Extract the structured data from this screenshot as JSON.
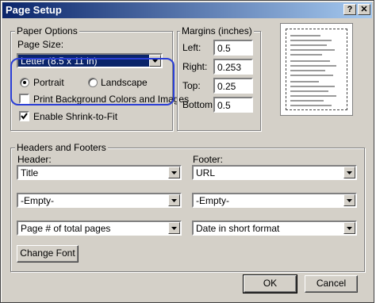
{
  "window": {
    "title": "Page Setup"
  },
  "paper_options": {
    "group_label": "Paper Options",
    "page_size_label": "Page Size:",
    "page_size_value": "Letter (8.5 x 11 in)",
    "portrait_label": "Portrait",
    "landscape_label": "Landscape",
    "orientation": "Portrait",
    "print_bg_label": "Print Background Colors and Images",
    "print_bg_checked": false,
    "shrink_label": "Enable Shrink-to-Fit",
    "shrink_checked": true
  },
  "margins": {
    "group_label": "Margins (inches)",
    "left_label": "Left:",
    "left_value": "0.5",
    "right_label": "Right:",
    "right_value": "0.253",
    "top_label": "Top:",
    "top_value": "0.25",
    "bottom_label": "Bottom:",
    "bottom_value": "0.5"
  },
  "headers_footers": {
    "group_label": "Headers and Footers",
    "header_label": "Header:",
    "footer_label": "Footer:",
    "header_values": [
      "Title",
      "-Empty-",
      "Page # of total pages"
    ],
    "footer_values": [
      "URL",
      "-Empty-",
      "Date in short format"
    ]
  },
  "buttons": {
    "change_font": "Change Font",
    "ok": "OK",
    "cancel": "Cancel"
  },
  "colors": {
    "title_bar": "#0a246a",
    "highlight": "#2b3fd6"
  }
}
